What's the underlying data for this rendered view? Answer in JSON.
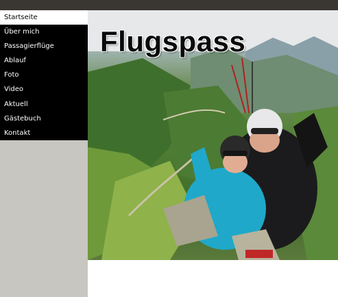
{
  "nav": {
    "items": [
      {
        "label": "Startseite",
        "active": true
      },
      {
        "label": "Über mich"
      },
      {
        "label": "Passagierflüge"
      },
      {
        "label": "Ablauf"
      },
      {
        "label": "Foto"
      },
      {
        "label": "Video"
      },
      {
        "label": "Aktuell"
      },
      {
        "label": "Gästebuch"
      },
      {
        "label": "Kontakt"
      }
    ]
  },
  "hero": {
    "title": "Flugspass",
    "image": "tandem-paragliding-photo"
  },
  "colors": {
    "topbar": "#3a3733",
    "sidebar_bg": "#c7c6c0",
    "nav_bg": "#000000",
    "nav_active_bg": "#ffffff"
  }
}
